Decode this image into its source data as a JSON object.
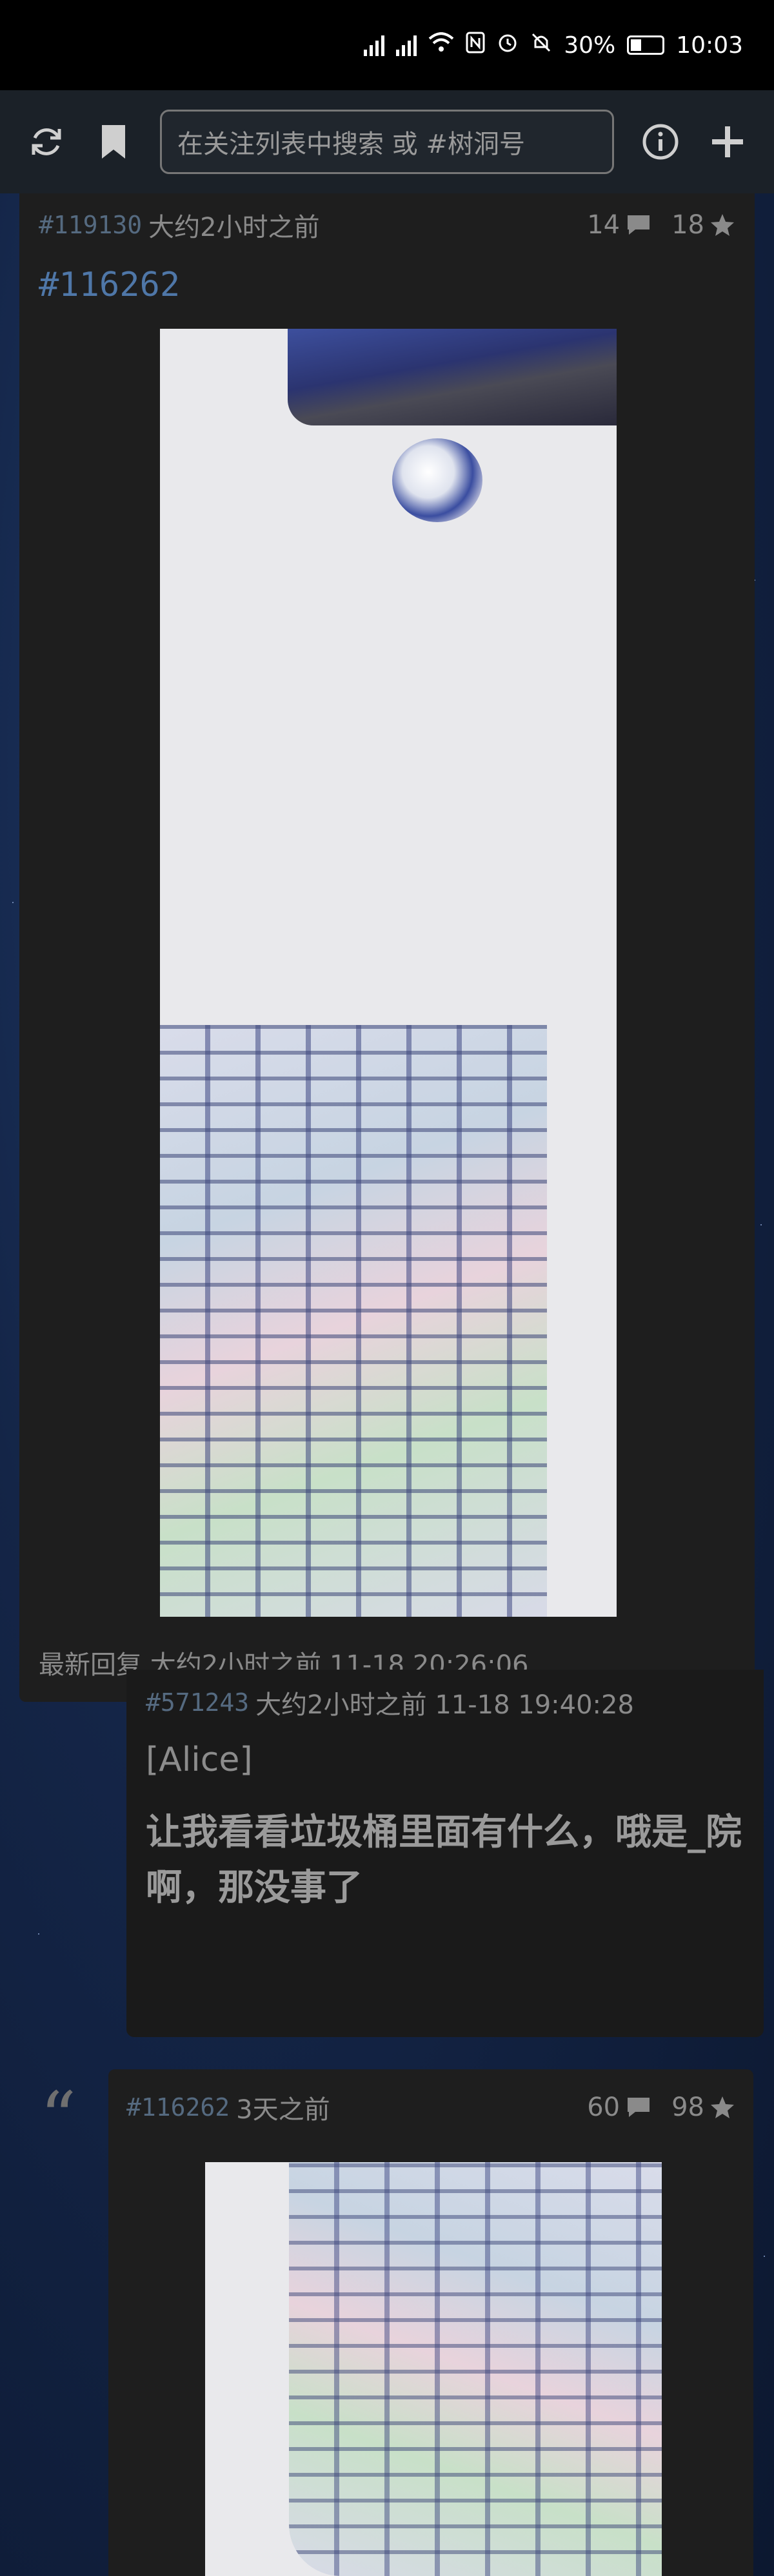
{
  "status_bar": {
    "battery": "30%",
    "time": "10:03"
  },
  "toolbar": {
    "search_placeholder": "在关注列表中搜索 或 #树洞号"
  },
  "post": {
    "pid": "#119130",
    "time_ago": "大约2小时之前",
    "reply_count": "14",
    "like_count": "18",
    "ref_link": "#116262",
    "latest_reply_label": "最新回复 大约2小时之前 11-18 20:26:06"
  },
  "reply": {
    "cid": "#571243",
    "time": "大约2小时之前 11-18 19:40:28",
    "author": "[Alice]",
    "content": "让我看看垃圾桶里面有什么，哦是_院啊，那没事了"
  },
  "quoted_post": {
    "pid": "#116262",
    "time_ago": "3天之前",
    "reply_count": "60",
    "like_count": "98"
  },
  "icons": [
    "refresh-icon",
    "bookmark-icon",
    "info-icon",
    "plus-icon",
    "comment-icon",
    "star-icon",
    "quote-icon"
  ]
}
